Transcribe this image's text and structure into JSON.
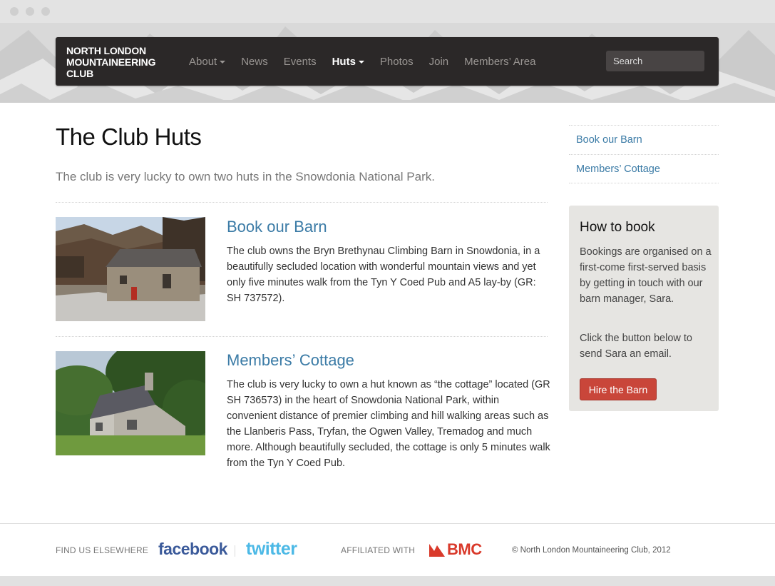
{
  "nav": {
    "brand": "NORTH LONDON MOUNTAINEERING CLUB",
    "items": [
      {
        "label": "About",
        "dropdown": true,
        "active": false
      },
      {
        "label": "News",
        "dropdown": false,
        "active": false
      },
      {
        "label": "Events",
        "dropdown": false,
        "active": false
      },
      {
        "label": "Huts",
        "dropdown": true,
        "active": true
      },
      {
        "label": "Photos",
        "dropdown": false,
        "active": false
      },
      {
        "label": "Join",
        "dropdown": false,
        "active": false
      },
      {
        "label": "Members’ Area",
        "dropdown": false,
        "active": false
      }
    ],
    "search_placeholder": "Search"
  },
  "main": {
    "title": "The Club Huts",
    "lead": "The club is very lucky to own two huts in the Snowdonia National Park.",
    "huts": [
      {
        "title": "Book our Barn",
        "text": "The club owns the Bryn Brethynau Climbing Barn in Snowdonia, in a beautifully secluded location with wonderful mountain views and yet only five minutes walk from the Tyn Y Coed Pub and A5 lay-by (GR: SH 737572)."
      },
      {
        "title": "Members’ Cottage",
        "text": "The club is very lucky to own a hut known as “the cottage” located (GR SH 736573) in the heart of Snowdonia National Park, within convenient distance of premier climbing and hill walking areas such as the Llanberis Pass, Tryfan, the Ogwen Valley, Tremadog and much more. Although beautifully secluded, the cottage is only 5 minutes walk from the Tyn Y Coed Pub."
      }
    ]
  },
  "sidebar": {
    "links": [
      "Book our Barn",
      "Members’ Cottage"
    ],
    "box": {
      "title": "How to book",
      "p1": "Bookings are organised on a first-come first-served basis by getting in touch with our barn manager, Sara.",
      "p2": "Click the button below to send Sara an email.",
      "button": "Hire the Barn"
    }
  },
  "footer": {
    "find_label": "FIND US ELSEWHERE",
    "facebook": "facebook",
    "twitter": "twitter",
    "affiliated_label": "AFFILIATED WITH",
    "bmc": "BMC",
    "copyright": "© North London Mountaineering Club, 2012"
  },
  "colors": {
    "link": "#3b7ba6",
    "navbar": "#2b2828",
    "button": "#c9463a",
    "facebook": "#3b5a9a",
    "twitter": "#4cb9e6",
    "bmc": "#d93a2b"
  }
}
